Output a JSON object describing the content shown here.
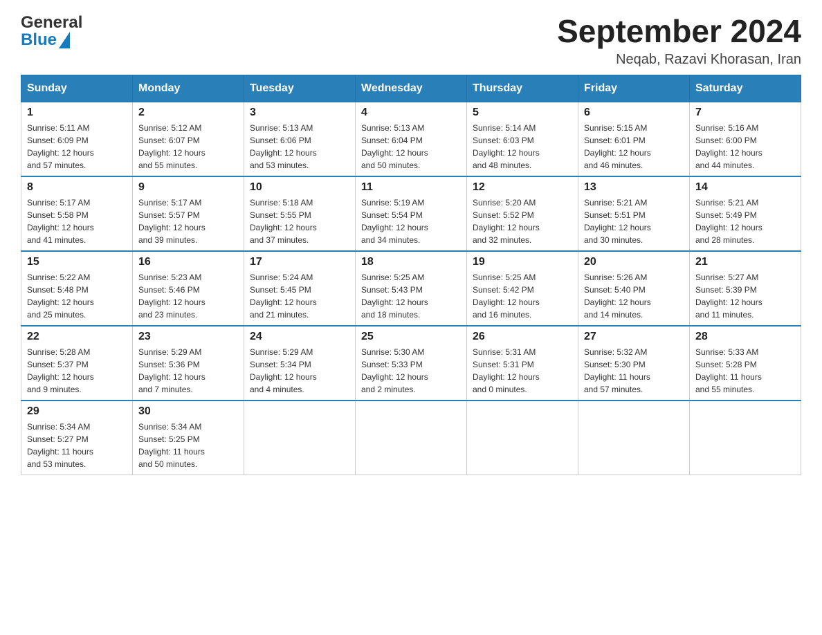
{
  "header": {
    "logo_general": "General",
    "logo_blue": "Blue",
    "title": "September 2024",
    "subtitle": "Neqab, Razavi Khorasan, Iran"
  },
  "weekdays": [
    "Sunday",
    "Monday",
    "Tuesday",
    "Wednesday",
    "Thursday",
    "Friday",
    "Saturday"
  ],
  "weeks": [
    [
      {
        "day": "1",
        "sunrise": "5:11 AM",
        "sunset": "6:09 PM",
        "daylight": "12 hours and 57 minutes."
      },
      {
        "day": "2",
        "sunrise": "5:12 AM",
        "sunset": "6:07 PM",
        "daylight": "12 hours and 55 minutes."
      },
      {
        "day": "3",
        "sunrise": "5:13 AM",
        "sunset": "6:06 PM",
        "daylight": "12 hours and 53 minutes."
      },
      {
        "day": "4",
        "sunrise": "5:13 AM",
        "sunset": "6:04 PM",
        "daylight": "12 hours and 50 minutes."
      },
      {
        "day": "5",
        "sunrise": "5:14 AM",
        "sunset": "6:03 PM",
        "daylight": "12 hours and 48 minutes."
      },
      {
        "day": "6",
        "sunrise": "5:15 AM",
        "sunset": "6:01 PM",
        "daylight": "12 hours and 46 minutes."
      },
      {
        "day": "7",
        "sunrise": "5:16 AM",
        "sunset": "6:00 PM",
        "daylight": "12 hours and 44 minutes."
      }
    ],
    [
      {
        "day": "8",
        "sunrise": "5:17 AM",
        "sunset": "5:58 PM",
        "daylight": "12 hours and 41 minutes."
      },
      {
        "day": "9",
        "sunrise": "5:17 AM",
        "sunset": "5:57 PM",
        "daylight": "12 hours and 39 minutes."
      },
      {
        "day": "10",
        "sunrise": "5:18 AM",
        "sunset": "5:55 PM",
        "daylight": "12 hours and 37 minutes."
      },
      {
        "day": "11",
        "sunrise": "5:19 AM",
        "sunset": "5:54 PM",
        "daylight": "12 hours and 34 minutes."
      },
      {
        "day": "12",
        "sunrise": "5:20 AM",
        "sunset": "5:52 PM",
        "daylight": "12 hours and 32 minutes."
      },
      {
        "day": "13",
        "sunrise": "5:21 AM",
        "sunset": "5:51 PM",
        "daylight": "12 hours and 30 minutes."
      },
      {
        "day": "14",
        "sunrise": "5:21 AM",
        "sunset": "5:49 PM",
        "daylight": "12 hours and 28 minutes."
      }
    ],
    [
      {
        "day": "15",
        "sunrise": "5:22 AM",
        "sunset": "5:48 PM",
        "daylight": "12 hours and 25 minutes."
      },
      {
        "day": "16",
        "sunrise": "5:23 AM",
        "sunset": "5:46 PM",
        "daylight": "12 hours and 23 minutes."
      },
      {
        "day": "17",
        "sunrise": "5:24 AM",
        "sunset": "5:45 PM",
        "daylight": "12 hours and 21 minutes."
      },
      {
        "day": "18",
        "sunrise": "5:25 AM",
        "sunset": "5:43 PM",
        "daylight": "12 hours and 18 minutes."
      },
      {
        "day": "19",
        "sunrise": "5:25 AM",
        "sunset": "5:42 PM",
        "daylight": "12 hours and 16 minutes."
      },
      {
        "day": "20",
        "sunrise": "5:26 AM",
        "sunset": "5:40 PM",
        "daylight": "12 hours and 14 minutes."
      },
      {
        "day": "21",
        "sunrise": "5:27 AM",
        "sunset": "5:39 PM",
        "daylight": "12 hours and 11 minutes."
      }
    ],
    [
      {
        "day": "22",
        "sunrise": "5:28 AM",
        "sunset": "5:37 PM",
        "daylight": "12 hours and 9 minutes."
      },
      {
        "day": "23",
        "sunrise": "5:29 AM",
        "sunset": "5:36 PM",
        "daylight": "12 hours and 7 minutes."
      },
      {
        "day": "24",
        "sunrise": "5:29 AM",
        "sunset": "5:34 PM",
        "daylight": "12 hours and 4 minutes."
      },
      {
        "day": "25",
        "sunrise": "5:30 AM",
        "sunset": "5:33 PM",
        "daylight": "12 hours and 2 minutes."
      },
      {
        "day": "26",
        "sunrise": "5:31 AM",
        "sunset": "5:31 PM",
        "daylight": "12 hours and 0 minutes."
      },
      {
        "day": "27",
        "sunrise": "5:32 AM",
        "sunset": "5:30 PM",
        "daylight": "11 hours and 57 minutes."
      },
      {
        "day": "28",
        "sunrise": "5:33 AM",
        "sunset": "5:28 PM",
        "daylight": "11 hours and 55 minutes."
      }
    ],
    [
      {
        "day": "29",
        "sunrise": "5:34 AM",
        "sunset": "5:27 PM",
        "daylight": "11 hours and 53 minutes."
      },
      {
        "day": "30",
        "sunrise": "5:34 AM",
        "sunset": "5:25 PM",
        "daylight": "11 hours and 50 minutes."
      },
      null,
      null,
      null,
      null,
      null
    ]
  ],
  "labels": {
    "sunrise": "Sunrise:",
    "sunset": "Sunset:",
    "daylight": "Daylight:"
  }
}
